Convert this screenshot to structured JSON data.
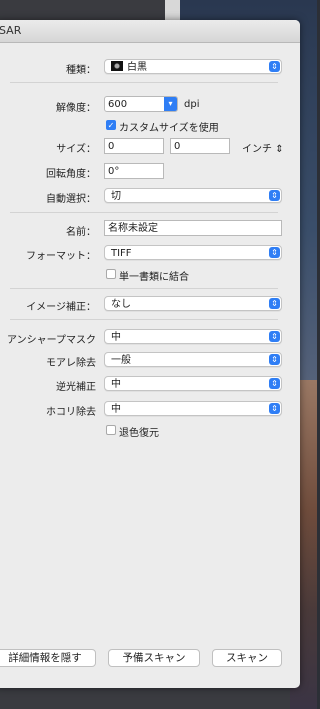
{
  "window": {
    "title": "SAR"
  },
  "fields": {
    "kind": {
      "label": "種類：",
      "value": "白黒",
      "icon": "bw-image-icon"
    },
    "resolution": {
      "label": "解像度：",
      "value": "600",
      "unit": "dpi"
    },
    "custom_size": {
      "label": "カスタムサイズを使用",
      "checked": true
    },
    "size": {
      "label": "サイズ：",
      "width": "0",
      "height": "0",
      "unit": "インチ"
    },
    "rotation": {
      "label": "回転角度：",
      "value": "0°"
    },
    "auto_select": {
      "label": "自動選択：",
      "value": "切"
    },
    "name": {
      "label": "名前：",
      "value": "名称未設定"
    },
    "format": {
      "label": "フォーマット：",
      "value": "TIFF"
    },
    "combine": {
      "label": "単一書類に結合",
      "checked": false
    },
    "image_correction": {
      "label": "イメージ補正：",
      "value": "なし"
    },
    "unsharp_mask": {
      "label": "アンシャープマスク",
      "value": "中"
    },
    "moire": {
      "label": "モアレ除去",
      "value": "一般"
    },
    "backlight": {
      "label": "逆光補正",
      "value": "中"
    },
    "dust": {
      "label": "ホコリ除去",
      "value": "中"
    },
    "fade_restore": {
      "label": "退色復元",
      "checked": false
    }
  },
  "buttons": {
    "hide_details": "詳細情報を隠す",
    "overview": "予備スキャン",
    "scan": "スキャン"
  }
}
